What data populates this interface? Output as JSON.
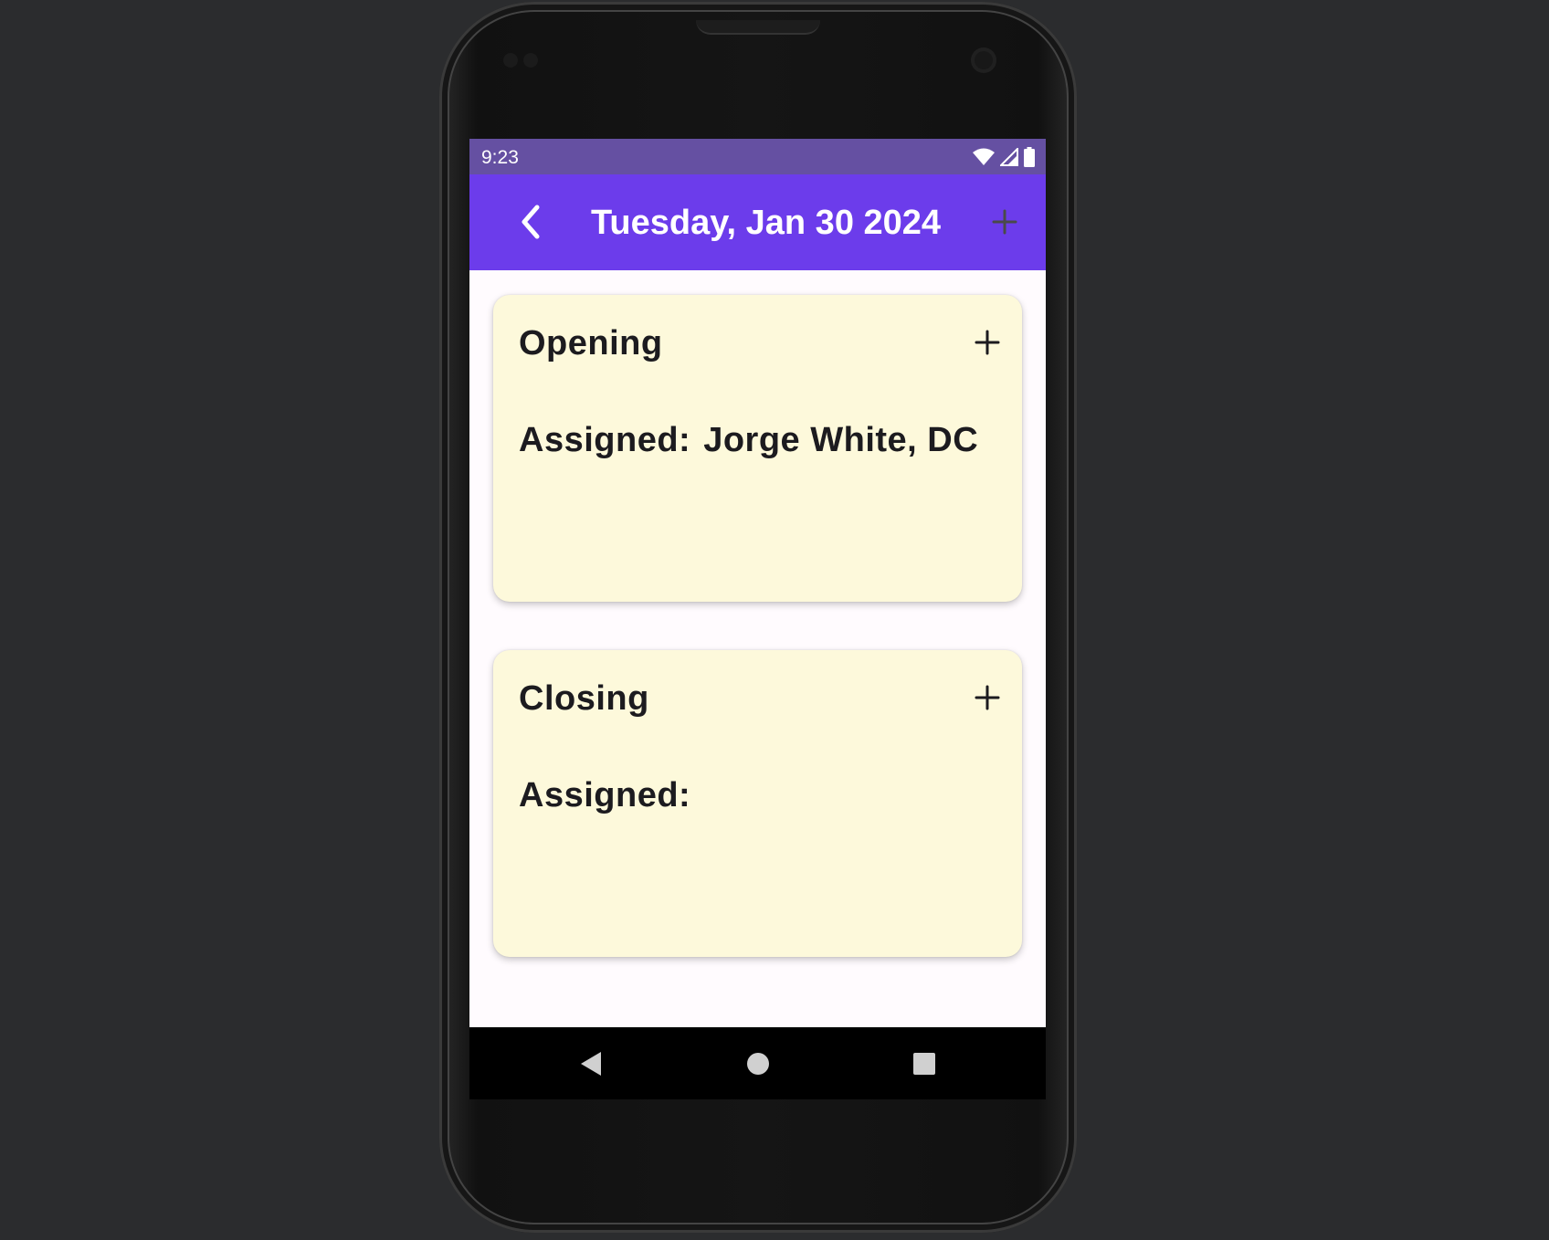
{
  "status_bar": {
    "time": "9:23",
    "icons": [
      "wifi-icon",
      "cellular-signal-icon",
      "battery-icon"
    ]
  },
  "app_bar": {
    "back_icon": "chevron-left-icon",
    "title": "Tuesday, Jan 30 2024",
    "add_icon": "plus-icon"
  },
  "shifts": [
    {
      "title": "Opening",
      "assigned_label": "Assigned:",
      "assignees": "Jorge White, DC",
      "add_icon": "plus-icon"
    },
    {
      "title": "Closing",
      "assigned_label": "Assigned:",
      "assignees": "",
      "add_icon": "plus-icon"
    }
  ],
  "nav_bar": {
    "items": [
      "back-triangle-icon",
      "home-circle-icon",
      "recents-square-icon"
    ]
  },
  "colors": {
    "status_bar": "#6550a2",
    "app_bar": "#6c3ceb",
    "card_background": "#fdf9db",
    "screen_background": "#fffbfe",
    "text": "#1c1b1f"
  }
}
